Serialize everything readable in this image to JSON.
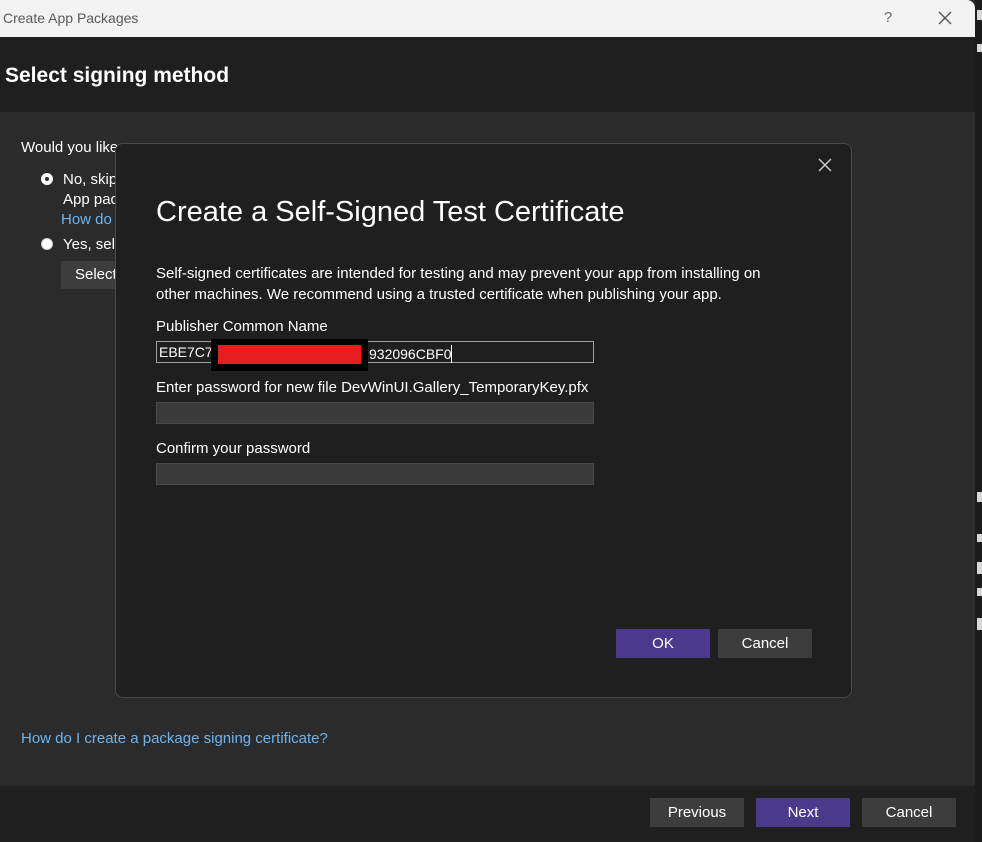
{
  "window": {
    "title": "Create App Packages",
    "help_label": "?",
    "header_title": "Select signing method"
  },
  "main": {
    "question": "Would you like",
    "option_no_label": "No, skip",
    "option_no_desc": "App pac",
    "option_no_link": "How do",
    "option_yes_label": "Yes, sele",
    "select_button": "Select",
    "bottom_link": "How do I create a package signing certificate?"
  },
  "footer": {
    "previous": "Previous",
    "next": "Next",
    "cancel": "Cancel"
  },
  "modal": {
    "title": "Create a Self-Signed Test Certificate",
    "description": "Self-signed certificates are intended for testing and may prevent your app from installing on other machines. We recommend using a trusted certificate when publishing your app.",
    "publisher_label": "Publisher Common Name",
    "publisher_prefix": "EBE7C7",
    "publisher_suffix": "932096CBF0",
    "password_label": "Enter password for new file DevWinUI.Gallery_TemporaryKey.pfx",
    "confirm_label": "Confirm your password",
    "ok": "OK",
    "cancel": "Cancel"
  },
  "colors": {
    "accent": "#4b3a8c",
    "link": "#6cb4ee",
    "redaction": "#e61d1d"
  },
  "icons": {
    "close": "close-icon"
  }
}
